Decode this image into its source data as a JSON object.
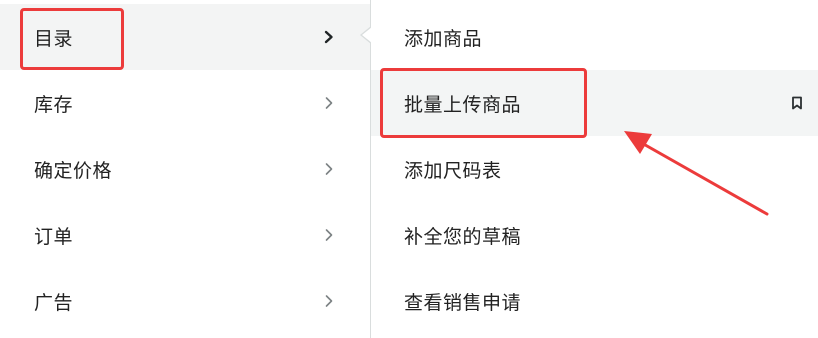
{
  "left_menu": {
    "items": [
      {
        "label": "目录",
        "active": true,
        "icon": "chevron-right-icon"
      },
      {
        "label": "库存",
        "active": false,
        "icon": "chevron-right-icon"
      },
      {
        "label": "确定价格",
        "active": false,
        "icon": "chevron-right-icon"
      },
      {
        "label": "订单",
        "active": false,
        "icon": "chevron-right-icon"
      },
      {
        "label": "广告",
        "active": false,
        "icon": "chevron-right-icon"
      }
    ]
  },
  "submenu": {
    "items": [
      {
        "label": "添加商品"
      },
      {
        "label": "批量上传商品",
        "hovered": true,
        "icon": "bookmark-icon"
      },
      {
        "label": "添加尺码表"
      },
      {
        "label": "补全您的草稿"
      },
      {
        "label": "查看销售申请"
      }
    ]
  },
  "annotations": {
    "color": "#ec3b3b",
    "highlighted": [
      "目录",
      "批量上传商品"
    ]
  }
}
